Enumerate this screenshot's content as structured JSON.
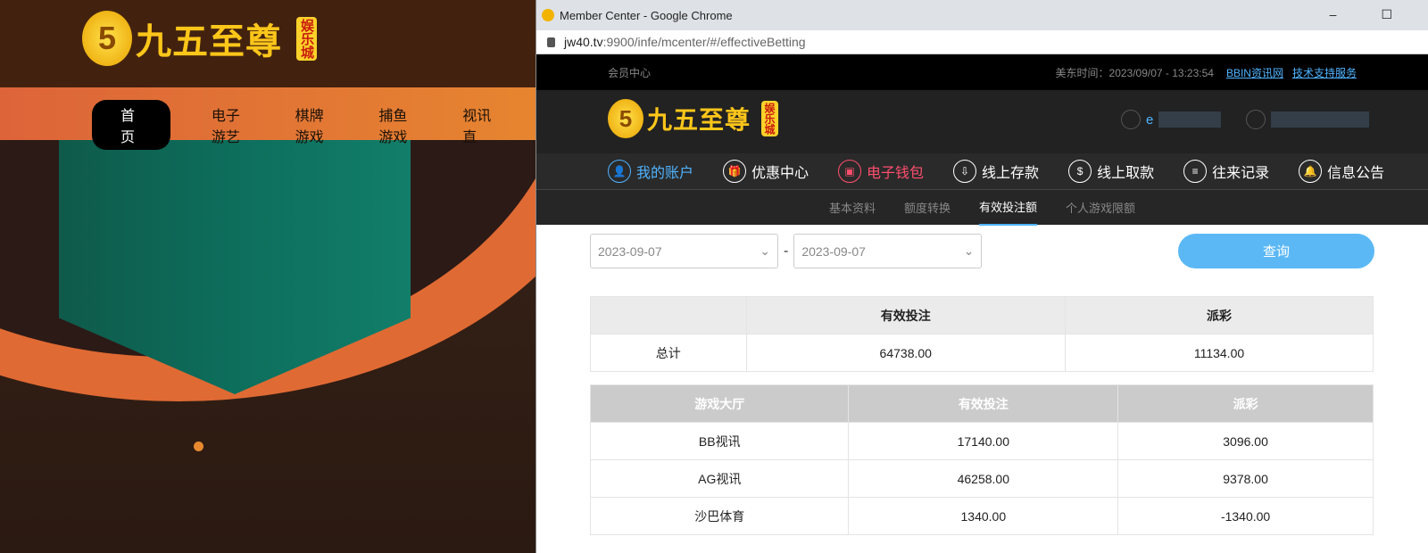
{
  "brand": {
    "name": "九五至尊",
    "badge": "娱乐城",
    "digit": "5"
  },
  "bg_nav": [
    "首页",
    "电子游艺",
    "棋牌游戏",
    "捕鱼游戏",
    "视讯直"
  ],
  "window": {
    "title": "Member Center - Google Chrome",
    "url_host": "jw40.tv",
    "url_path": ":9900/infe/mcenter/#/effectiveBetting",
    "minimize": "–",
    "maximize": "☐"
  },
  "topbar": {
    "label": "会员中心",
    "time": "美东时间：2023/09/07 - 13:23:54",
    "links": [
      "BBIN资讯网",
      "技术支持服务"
    ]
  },
  "user": {
    "name": "e"
  },
  "main_nav": [
    {
      "label": "我的账户",
      "icon": "user-icon",
      "glyph": "👤",
      "color": "#4fb3ff"
    },
    {
      "label": "优惠中心",
      "icon": "gift-icon",
      "glyph": "🎁",
      "color": "#ffffff"
    },
    {
      "label": "电子钱包",
      "icon": "wallet-icon",
      "glyph": "▣",
      "color": "#ff4e6e"
    },
    {
      "label": "线上存款",
      "icon": "deposit-icon",
      "glyph": "⇩",
      "color": "#ffffff"
    },
    {
      "label": "线上取款",
      "icon": "withdraw-icon",
      "glyph": "$",
      "color": "#ffffff"
    },
    {
      "label": "往来记录",
      "icon": "record-icon",
      "glyph": "≡",
      "color": "#ffffff"
    },
    {
      "label": "信息公告",
      "icon": "bell-icon",
      "glyph": "🔔",
      "color": "#ffffff"
    }
  ],
  "sub_tabs": [
    {
      "label": "基本资料"
    },
    {
      "label": "额度转换"
    },
    {
      "label": "有效投注额",
      "active": true
    },
    {
      "label": "个人游戏限额"
    }
  ],
  "filters": {
    "start": "2023-09-07",
    "end": "2023-09-07",
    "sep": "-",
    "query": "查询"
  },
  "summary": {
    "headers": [
      "",
      "有效投注",
      "派彩"
    ],
    "row": [
      "总计",
      "64738.00",
      "11134.00"
    ]
  },
  "detail": {
    "headers": [
      "游戏大厅",
      "有效投注",
      "派彩"
    ],
    "rows": [
      [
        "BB视讯",
        "17140.00",
        "3096.00"
      ],
      [
        "AG视讯",
        "46258.00",
        "9378.00"
      ],
      [
        "沙巴体育",
        "1340.00",
        "-1340.00"
      ]
    ]
  }
}
